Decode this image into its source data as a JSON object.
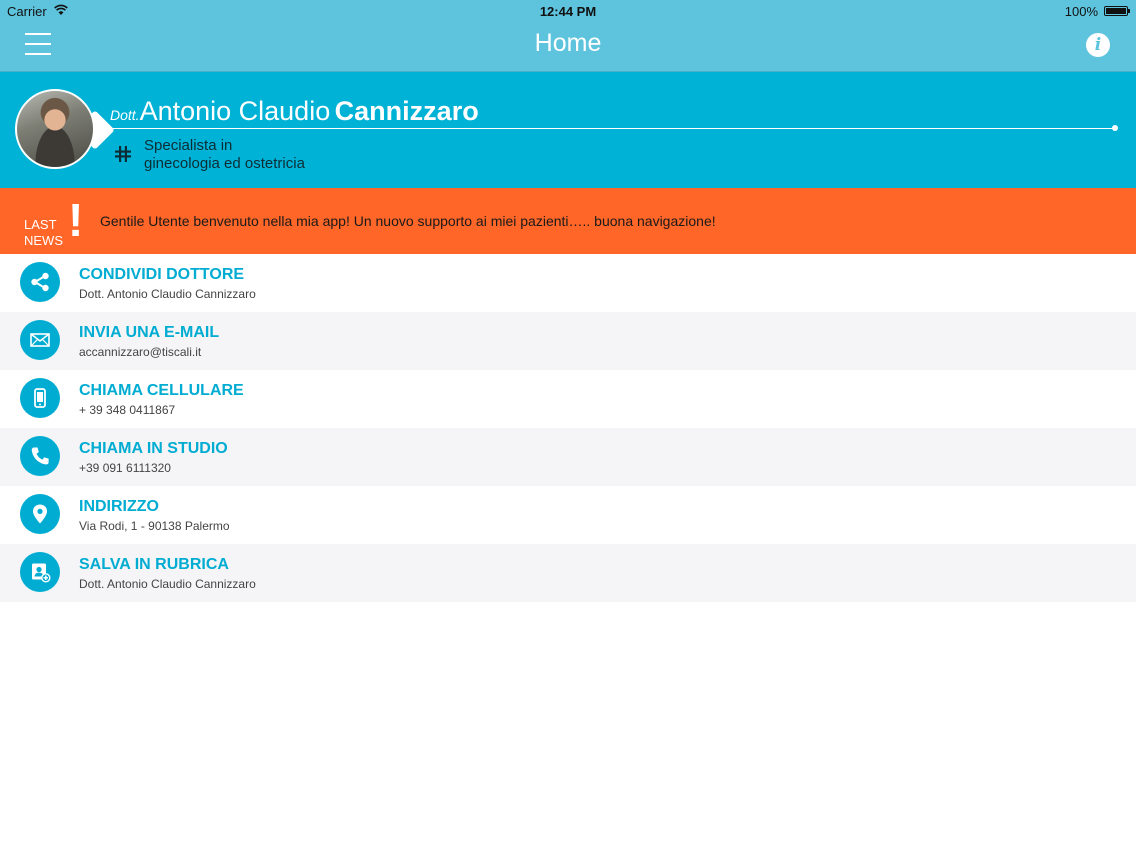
{
  "status_bar": {
    "carrier": "Carrier",
    "time": "12:44 PM",
    "battery": "100%"
  },
  "navbar": {
    "title": "Home",
    "menu_icon": "hamburger-icon",
    "info_icon": "info-icon",
    "info_label": "i"
  },
  "doctor": {
    "prefix": "Dott.",
    "first_names": "Antonio Claudio",
    "last_name": "Cannizzaro",
    "specialty_line1": "Specialista in",
    "specialty_line2": "ginecologia ed ostetricia"
  },
  "news": {
    "label_line1": "LAST",
    "label_line2": "NEWS",
    "mark": "!",
    "text": "Gentile Utente benvenuto nella mia app! Un nuovo supporto ai miei pazienti….. buona navigazione!"
  },
  "items": [
    {
      "title": "CONDIVIDI DOTTORE",
      "subtitle": "Dott. Antonio Claudio Cannizzaro",
      "icon": "share-icon"
    },
    {
      "title": "INVIA UNA E-MAIL",
      "subtitle": "accannizzaro@tiscali.it",
      "icon": "envelope-icon"
    },
    {
      "title": "CHIAMA CELLULARE",
      "subtitle": "+ 39 348 0411867",
      "icon": "mobile-phone-icon"
    },
    {
      "title": "CHIAMA IN STUDIO",
      "subtitle": "+39 091 6111320",
      "icon": "phone-icon"
    },
    {
      "title": "INDIRIZZO",
      "subtitle": "Via Rodi, 1 - 90138 Palermo",
      "icon": "map-pin-icon"
    },
    {
      "title": "SALVA IN RUBRICA",
      "subtitle": "Dott. Antonio Claudio Cannizzaro",
      "icon": "add-contact-icon"
    }
  ],
  "colors": {
    "navbar": "#5ec4de",
    "header": "#00b2d6",
    "news": "#ff6627",
    "accent": "#00acd2"
  }
}
